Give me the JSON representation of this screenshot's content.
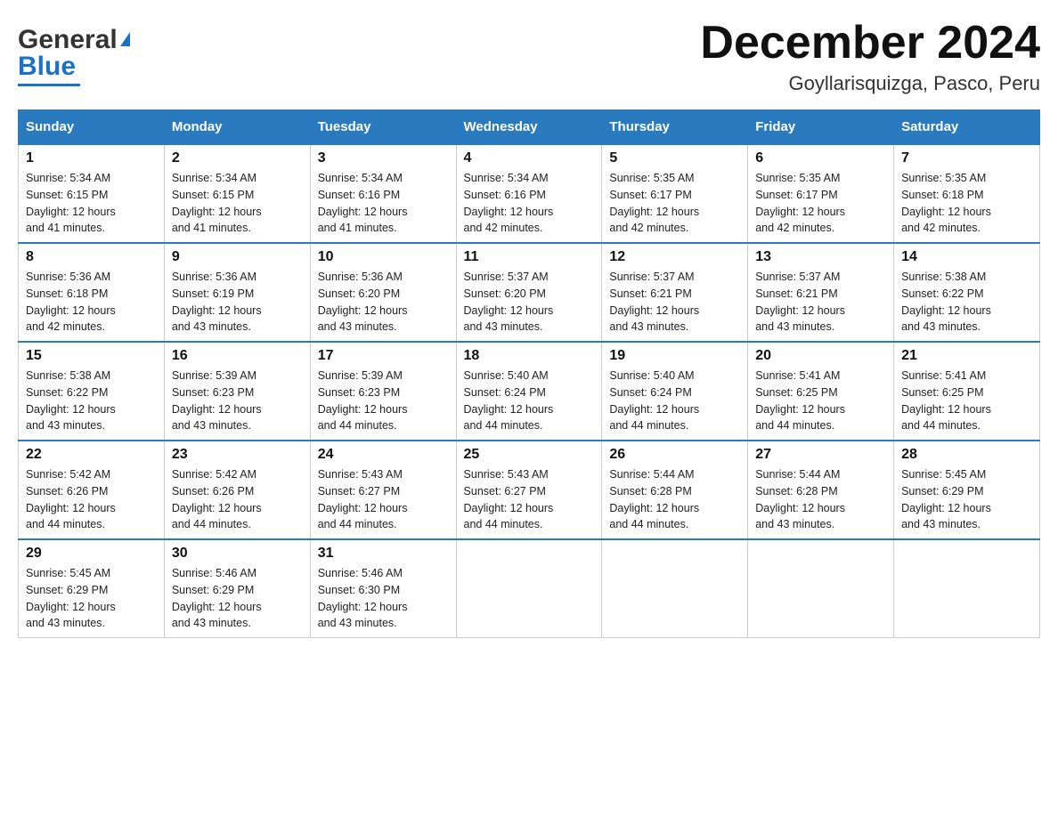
{
  "logo": {
    "text_general": "General",
    "text_blue": "Blue",
    "triangle_color": "#1a73c7"
  },
  "title": "December 2024",
  "subtitle": "Goyllarisquizga, Pasco, Peru",
  "days_of_week": [
    "Sunday",
    "Monday",
    "Tuesday",
    "Wednesday",
    "Thursday",
    "Friday",
    "Saturday"
  ],
  "weeks": [
    [
      {
        "day": "1",
        "sunrise": "5:34 AM",
        "sunset": "6:15 PM",
        "daylight": "12 hours and 41 minutes."
      },
      {
        "day": "2",
        "sunrise": "5:34 AM",
        "sunset": "6:15 PM",
        "daylight": "12 hours and 41 minutes."
      },
      {
        "day": "3",
        "sunrise": "5:34 AM",
        "sunset": "6:16 PM",
        "daylight": "12 hours and 41 minutes."
      },
      {
        "day": "4",
        "sunrise": "5:34 AM",
        "sunset": "6:16 PM",
        "daylight": "12 hours and 42 minutes."
      },
      {
        "day": "5",
        "sunrise": "5:35 AM",
        "sunset": "6:17 PM",
        "daylight": "12 hours and 42 minutes."
      },
      {
        "day": "6",
        "sunrise": "5:35 AM",
        "sunset": "6:17 PM",
        "daylight": "12 hours and 42 minutes."
      },
      {
        "day": "7",
        "sunrise": "5:35 AM",
        "sunset": "6:18 PM",
        "daylight": "12 hours and 42 minutes."
      }
    ],
    [
      {
        "day": "8",
        "sunrise": "5:36 AM",
        "sunset": "6:18 PM",
        "daylight": "12 hours and 42 minutes."
      },
      {
        "day": "9",
        "sunrise": "5:36 AM",
        "sunset": "6:19 PM",
        "daylight": "12 hours and 43 minutes."
      },
      {
        "day": "10",
        "sunrise": "5:36 AM",
        "sunset": "6:20 PM",
        "daylight": "12 hours and 43 minutes."
      },
      {
        "day": "11",
        "sunrise": "5:37 AM",
        "sunset": "6:20 PM",
        "daylight": "12 hours and 43 minutes."
      },
      {
        "day": "12",
        "sunrise": "5:37 AM",
        "sunset": "6:21 PM",
        "daylight": "12 hours and 43 minutes."
      },
      {
        "day": "13",
        "sunrise": "5:37 AM",
        "sunset": "6:21 PM",
        "daylight": "12 hours and 43 minutes."
      },
      {
        "day": "14",
        "sunrise": "5:38 AM",
        "sunset": "6:22 PM",
        "daylight": "12 hours and 43 minutes."
      }
    ],
    [
      {
        "day": "15",
        "sunrise": "5:38 AM",
        "sunset": "6:22 PM",
        "daylight": "12 hours and 43 minutes."
      },
      {
        "day": "16",
        "sunrise": "5:39 AM",
        "sunset": "6:23 PM",
        "daylight": "12 hours and 43 minutes."
      },
      {
        "day": "17",
        "sunrise": "5:39 AM",
        "sunset": "6:23 PM",
        "daylight": "12 hours and 44 minutes."
      },
      {
        "day": "18",
        "sunrise": "5:40 AM",
        "sunset": "6:24 PM",
        "daylight": "12 hours and 44 minutes."
      },
      {
        "day": "19",
        "sunrise": "5:40 AM",
        "sunset": "6:24 PM",
        "daylight": "12 hours and 44 minutes."
      },
      {
        "day": "20",
        "sunrise": "5:41 AM",
        "sunset": "6:25 PM",
        "daylight": "12 hours and 44 minutes."
      },
      {
        "day": "21",
        "sunrise": "5:41 AM",
        "sunset": "6:25 PM",
        "daylight": "12 hours and 44 minutes."
      }
    ],
    [
      {
        "day": "22",
        "sunrise": "5:42 AM",
        "sunset": "6:26 PM",
        "daylight": "12 hours and 44 minutes."
      },
      {
        "day": "23",
        "sunrise": "5:42 AM",
        "sunset": "6:26 PM",
        "daylight": "12 hours and 44 minutes."
      },
      {
        "day": "24",
        "sunrise": "5:43 AM",
        "sunset": "6:27 PM",
        "daylight": "12 hours and 44 minutes."
      },
      {
        "day": "25",
        "sunrise": "5:43 AM",
        "sunset": "6:27 PM",
        "daylight": "12 hours and 44 minutes."
      },
      {
        "day": "26",
        "sunrise": "5:44 AM",
        "sunset": "6:28 PM",
        "daylight": "12 hours and 44 minutes."
      },
      {
        "day": "27",
        "sunrise": "5:44 AM",
        "sunset": "6:28 PM",
        "daylight": "12 hours and 43 minutes."
      },
      {
        "day": "28",
        "sunrise": "5:45 AM",
        "sunset": "6:29 PM",
        "daylight": "12 hours and 43 minutes."
      }
    ],
    [
      {
        "day": "29",
        "sunrise": "5:45 AM",
        "sunset": "6:29 PM",
        "daylight": "12 hours and 43 minutes."
      },
      {
        "day": "30",
        "sunrise": "5:46 AM",
        "sunset": "6:29 PM",
        "daylight": "12 hours and 43 minutes."
      },
      {
        "day": "31",
        "sunrise": "5:46 AM",
        "sunset": "6:30 PM",
        "daylight": "12 hours and 43 minutes."
      },
      null,
      null,
      null,
      null
    ]
  ]
}
